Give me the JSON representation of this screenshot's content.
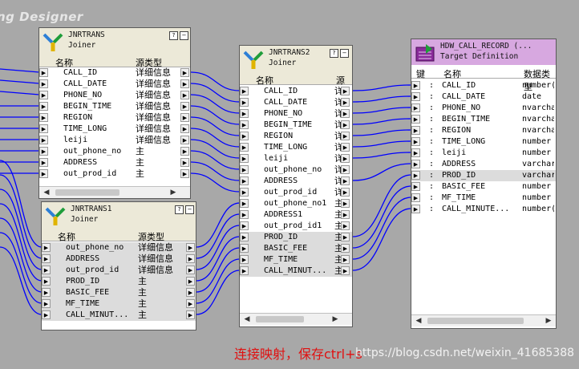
{
  "app": {
    "title_fragment": "ng Designer"
  },
  "caption": "连接映射，保存ctrl+s",
  "watermark": "https://blog.csdn.net/weixin_41685388",
  "colors": {
    "link": "#0000ff",
    "canvas": "#a8a8a8"
  },
  "jnrtrans": {
    "name": "JNRTRANS",
    "type": "Joiner",
    "col_name": "名称",
    "col_type": "源类型",
    "help": "?",
    "min": "−",
    "rows": [
      {
        "name": "CALL_ID",
        "type": "详细信息"
      },
      {
        "name": "CALL_DATE",
        "type": "详细信息"
      },
      {
        "name": "PHONE_NO",
        "type": "详细信息"
      },
      {
        "name": "BEGIN_TIME",
        "type": "详细信息"
      },
      {
        "name": "REGION",
        "type": "详细信息"
      },
      {
        "name": "TIME_LONG",
        "type": "详细信息"
      },
      {
        "name": "leiji",
        "type": "详细信息"
      },
      {
        "name": "out_phone_no",
        "type": "主"
      },
      {
        "name": "ADDRESS",
        "type": "主"
      },
      {
        "name": "out_prod_id",
        "type": "主"
      }
    ]
  },
  "jnrtrans1": {
    "name": "JNRTRANS1",
    "type": "Joiner",
    "col_name": "名称",
    "col_type": "源类型",
    "help": "?",
    "min": "−",
    "rows": [
      {
        "name": "out_phone_no",
        "type": "详细信息"
      },
      {
        "name": "ADDRESS",
        "type": "详细信息"
      },
      {
        "name": "out_prod_id",
        "type": "详细信息"
      },
      {
        "name": "PROD_ID",
        "type": "主"
      },
      {
        "name": "BASIC_FEE",
        "type": "主"
      },
      {
        "name": "MF_TIME",
        "type": "主"
      },
      {
        "name": "CALL_MINUT...",
        "type": "主"
      }
    ]
  },
  "jnrtrans2": {
    "name": "JNRTRANS2",
    "type": "Joiner",
    "col_name": "名称",
    "col_type": "源",
    "help": "?",
    "min": "−",
    "rows": [
      {
        "name": "CALL_ID",
        "type": "详"
      },
      {
        "name": "CALL_DATE",
        "type": "详"
      },
      {
        "name": "PHONE_NO",
        "type": "详"
      },
      {
        "name": "BEGIN_TIME",
        "type": "详"
      },
      {
        "name": "REGION",
        "type": "详"
      },
      {
        "name": "TIME_LONG",
        "type": "详"
      },
      {
        "name": "leiji",
        "type": "详"
      },
      {
        "name": "out_phone_no",
        "type": "详"
      },
      {
        "name": "ADDRESS",
        "type": "详"
      },
      {
        "name": "out_prod_id",
        "type": "详"
      },
      {
        "name": "out_phone_no1",
        "type": "主"
      },
      {
        "name": "ADDRESS1",
        "type": "主"
      },
      {
        "name": "out_prod_id1",
        "type": "主"
      },
      {
        "name": "PROD_ID",
        "type": "主"
      },
      {
        "name": "BASIC_FEE",
        "type": "主"
      },
      {
        "name": "MF_TIME",
        "type": "主"
      },
      {
        "name": "CALL_MINUT...",
        "type": "主"
      }
    ]
  },
  "target": {
    "name": "HDW_CALL_RECORD (...",
    "type": "Target Definition",
    "col_key": "键",
    "col_name": "名称",
    "col_type": "数据类型",
    "help": "?",
    "min": "−",
    "rows": [
      {
        "name": "CALL_ID",
        "type": "number("
      },
      {
        "name": "CALL_DATE",
        "type": "date"
      },
      {
        "name": "PHONE_NO",
        "type": "nvarchar"
      },
      {
        "name": "BEGIN_TIME",
        "type": "nvarchar"
      },
      {
        "name": "REGION",
        "type": "nvarchar"
      },
      {
        "name": "TIME_LONG",
        "type": "number"
      },
      {
        "name": "leiji",
        "type": "number"
      },
      {
        "name": "ADDRESS",
        "type": "varchar"
      },
      {
        "name": "PROD_ID",
        "type": "varchar"
      },
      {
        "name": "BASIC_FEE",
        "type": "number"
      },
      {
        "name": "MF_TIME",
        "type": "number"
      },
      {
        "name": "CALL_MINUTE...",
        "type": "number("
      }
    ]
  }
}
